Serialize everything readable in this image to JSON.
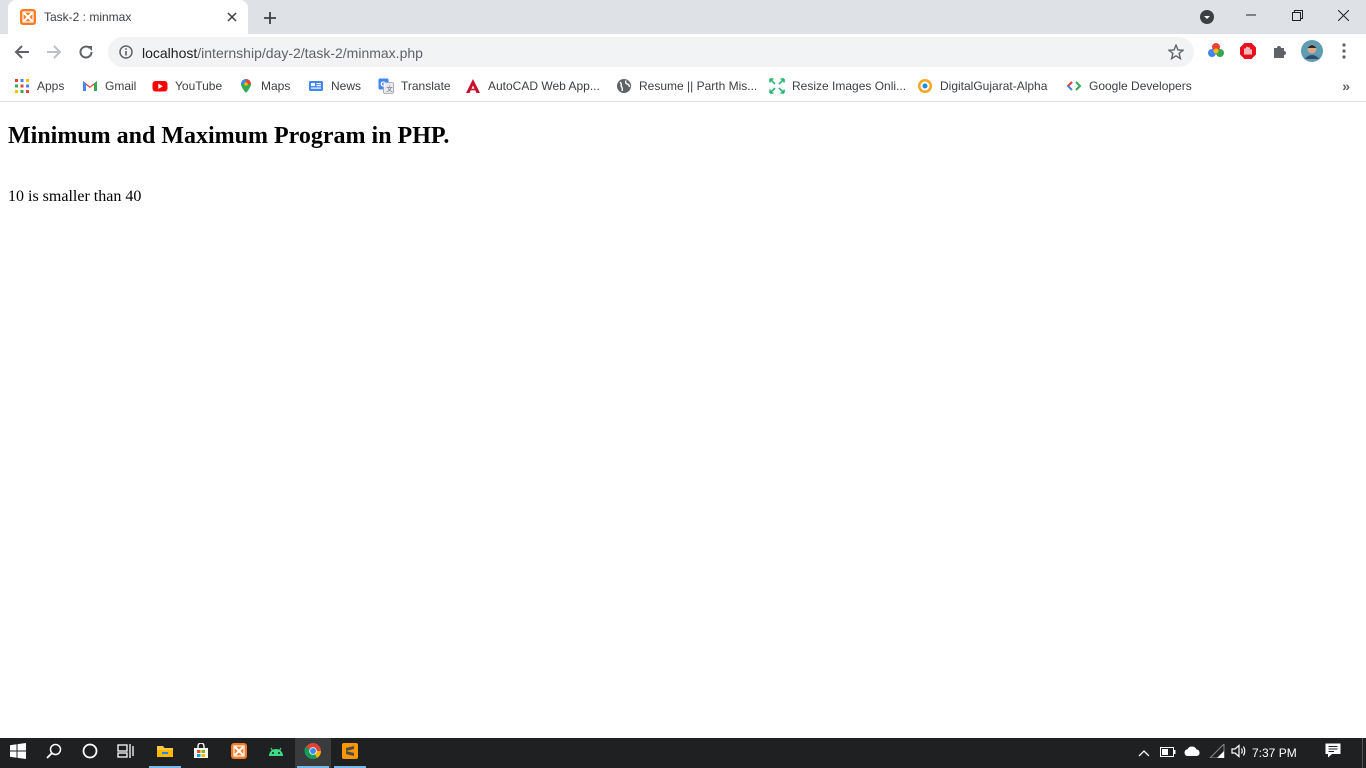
{
  "browser": {
    "tab": {
      "title": "Task-2 : minmax",
      "favicon": "xampp-icon"
    },
    "address_bar": {
      "host": "localhost",
      "path": "/internship/day-2/task-2/minmax.php"
    },
    "bookmarks": [
      {
        "label": "Apps",
        "icon": "apps-grid-icon"
      },
      {
        "label": "Gmail",
        "icon": "gmail-icon"
      },
      {
        "label": "YouTube",
        "icon": "youtube-icon"
      },
      {
        "label": "Maps",
        "icon": "maps-pin-icon"
      },
      {
        "label": "News",
        "icon": "news-icon"
      },
      {
        "label": "Translate",
        "icon": "translate-icon"
      },
      {
        "label": "AutoCAD Web App...",
        "icon": "autocad-icon"
      },
      {
        "label": "Resume || Parth Mis...",
        "icon": "globe-icon"
      },
      {
        "label": "Resize Images Onli...",
        "icon": "resize-icon"
      },
      {
        "label": "DigitalGujarat-Alpha",
        "icon": "digitalgujarat-icon"
      },
      {
        "label": "Google Developers",
        "icon": "google-developers-icon"
      }
    ],
    "bookmarks_overflow": "»"
  },
  "page": {
    "heading": "Minimum and Maximum Program in PHP.",
    "result": "10 is smaller than 40"
  },
  "taskbar": {
    "clock": "7:37 PM",
    "apps": [
      "start-icon",
      "search-icon",
      "cortana-icon",
      "task-view-icon",
      "file-explorer-icon",
      "store-icon",
      "xampp-icon",
      "android-studio-icon",
      "chrome-icon",
      "sublime-text-icon"
    ]
  },
  "colors": {
    "tabstrip": "#dee1e6",
    "omnibox": "#f1f3f4",
    "taskbar": "#1f2022",
    "accent": "#76b9ed"
  }
}
